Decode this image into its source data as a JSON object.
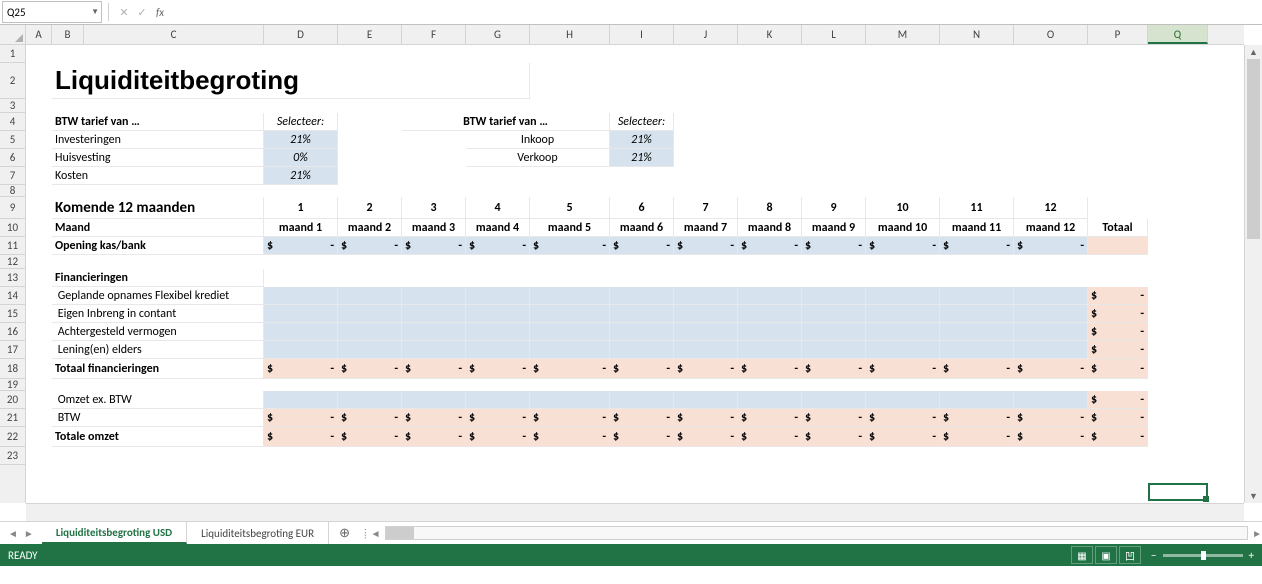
{
  "name_box": "Q25",
  "formula_input": "",
  "columns": [
    {
      "l": "A",
      "w": 26
    },
    {
      "l": "B",
      "w": 32
    },
    {
      "l": "C",
      "w": 180
    },
    {
      "l": "D",
      "w": 74
    },
    {
      "l": "E",
      "w": 64
    },
    {
      "l": "F",
      "w": 64
    },
    {
      "l": "G",
      "w": 64
    },
    {
      "l": "H",
      "w": 80
    },
    {
      "l": "I",
      "w": 64
    },
    {
      "l": "J",
      "w": 64
    },
    {
      "l": "K",
      "w": 64
    },
    {
      "l": "L",
      "w": 64
    },
    {
      "l": "M",
      "w": 74
    },
    {
      "l": "N",
      "w": 74
    },
    {
      "l": "O",
      "w": 74
    },
    {
      "l": "P",
      "w": 60
    },
    {
      "l": "Q",
      "w": 60
    }
  ],
  "active_col": "Q",
  "row_heights": {
    "1": 18,
    "2": 36,
    "3": 14,
    "4": 18,
    "5": 18,
    "6": 18,
    "7": 18,
    "8": 12,
    "9": 22,
    "10": 18,
    "11": 18,
    "12": 14,
    "13": 18,
    "14": 18,
    "15": 18,
    "16": 18,
    "17": 18,
    "18": 20,
    "19": 12,
    "20": 18,
    "21": 18,
    "22": 20
  },
  "title": "Liquiditeitbegroting",
  "btw_left_header": "BTW tarief van …",
  "selecteer": "Selecteer:",
  "btw_left": [
    {
      "label": "Investeringen",
      "val": "21%"
    },
    {
      "label": "Huisvesting",
      "val": "0%"
    },
    {
      "label": "Kosten",
      "val": "21%"
    }
  ],
  "btw_right_header": "BTW tarief van …",
  "btw_right": [
    {
      "label": "Inkoop",
      "val": "21%"
    },
    {
      "label": "Verkoop",
      "val": "21%"
    }
  ],
  "komende": "Komende 12 maanden",
  "month_nums": [
    "1",
    "2",
    "3",
    "4",
    "5",
    "6",
    "7",
    "8",
    "9",
    "10",
    "11",
    "12"
  ],
  "maand_label": "Maand",
  "maand_cols": [
    "maand 1",
    "maand 2",
    "maand 3",
    "maand 4",
    "maand 5",
    "maand 6",
    "maand 7",
    "maand 8",
    "maand 9",
    "maand 10",
    "maand 11",
    "maand 12"
  ],
  "totaal": "Totaal",
  "opening": "Opening kas/bank",
  "financieringen": "Financieringen",
  "fin_rows": [
    "Geplande opnames Flexibel krediet",
    "Eigen Inbreng in contant",
    "Achtergesteld vermogen",
    "Lening(en) elders"
  ],
  "totaal_fin": "Totaal financieringen",
  "omzet_ex": "Omzet ex. BTW",
  "btw_row": "BTW",
  "totale_omzet": "Totale omzet",
  "dollar": "$",
  "dash": "-",
  "tabs": {
    "active": "Liquiditeitsbegroting USD",
    "other": "Liquiditeitsbegroting EUR"
  },
  "status": "READY"
}
